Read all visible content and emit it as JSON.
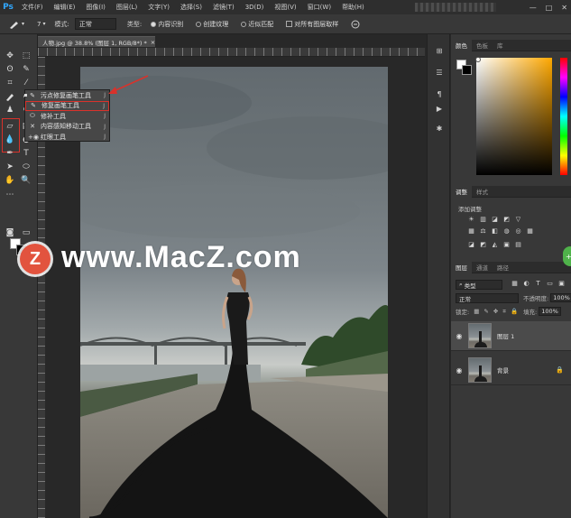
{
  "app": {
    "logo": "Ps",
    "menu": [
      "文件(F)",
      "编辑(E)",
      "图像(I)",
      "图层(L)",
      "文字(Y)",
      "选择(S)",
      "滤镜(T)",
      "3D(D)",
      "视图(V)",
      "窗口(W)",
      "帮助(H)"
    ],
    "window_controls": [
      "—",
      "□",
      "✕"
    ]
  },
  "options_bar": {
    "brush_size": "7",
    "mode_label": "模式:",
    "mode_value": "正常",
    "type_label": "类型:",
    "type_options": [
      {
        "label": "内容识别",
        "selected": true
      },
      {
        "label": "创建纹理",
        "selected": false
      },
      {
        "label": "近似匹配",
        "selected": false
      }
    ],
    "sample_all_label": "对所有图层取样"
  },
  "document": {
    "tab_title": "人物.jpg @ 38.8% (图层 1, RGB/8*) *",
    "tab_close": "×"
  },
  "toolbar": {
    "fg_color": "#ffffff",
    "bg_color": "#000000"
  },
  "flyout": {
    "items": [
      {
        "icon": "spot-healing-brush-icon",
        "label": "污点修复画笔工具",
        "shortcut": "J"
      },
      {
        "icon": "healing-brush-icon",
        "label": "修复画笔工具",
        "shortcut": "J"
      },
      {
        "icon": "patch-icon",
        "label": "修补工具",
        "shortcut": "J"
      },
      {
        "icon": "content-aware-move-icon",
        "label": "内容感知移动工具",
        "shortcut": "J"
      },
      {
        "icon": "red-eye-icon",
        "label": "红眼工具",
        "shortcut": "J"
      }
    ]
  },
  "watermark": {
    "logo_letter": "Z",
    "text": "www.MacZ.com",
    "logo_color": "#e2533e"
  },
  "panels": {
    "color_tabs": [
      "颜色",
      "色板",
      "库"
    ],
    "adjust_tabs": [
      "调整",
      "样式"
    ],
    "adjust_title": "添加调整",
    "layers_tabs": [
      "图层",
      "通道",
      "路径"
    ],
    "layer_filter": "类型",
    "blend_mode": "正常",
    "opacity_label": "不透明度:",
    "opacity_value": "100%",
    "lock_label": "锁定:",
    "fill_label": "填充:",
    "fill_value": "100%",
    "layers": [
      {
        "name": "图层 1",
        "selected": true,
        "visible": true,
        "locked": false
      },
      {
        "name": "背景",
        "selected": false,
        "visible": true,
        "locked": true
      }
    ]
  }
}
